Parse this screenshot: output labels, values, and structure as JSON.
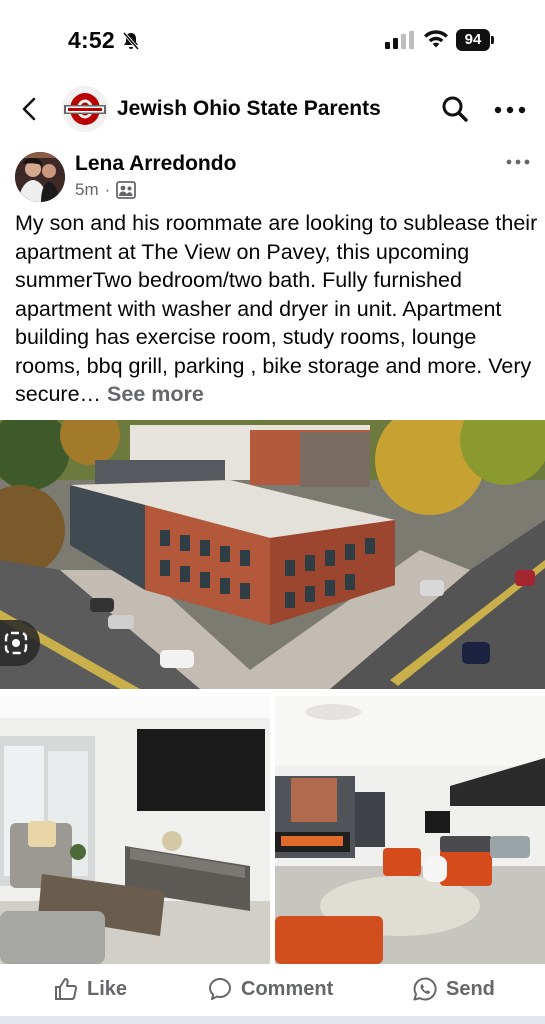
{
  "status_bar": {
    "time": "4:52",
    "battery": "94",
    "icons": [
      "bell-slash-icon",
      "cellular-signal-icon",
      "wifi-icon",
      "battery-icon"
    ]
  },
  "group": {
    "title": "Jewish Ohio State Parents",
    "logo_icon": "ohio-state-logo-icon",
    "colors": {
      "scarlet": "#bb0000",
      "gray": "#666666"
    }
  },
  "post": {
    "author": "Lena Arredondo",
    "time": "5m",
    "separator": "·",
    "body": "My son and his roommate are looking to sublease their apartment at The View on Pavey, this upcoming summerTwo bedroom/two bath. Fully furnished apartment with washer and dryer in unit. Apartment building has exercise room, study rooms, lounge rooms, bbq grill, parking , bike storage and more. Very secure…",
    "see_more": "See more",
    "images": [
      "aerial-building-photo",
      "living-room-photo",
      "lounge-photo"
    ]
  },
  "actions": {
    "like": "Like",
    "comment": "Comment",
    "send": "Send"
  }
}
